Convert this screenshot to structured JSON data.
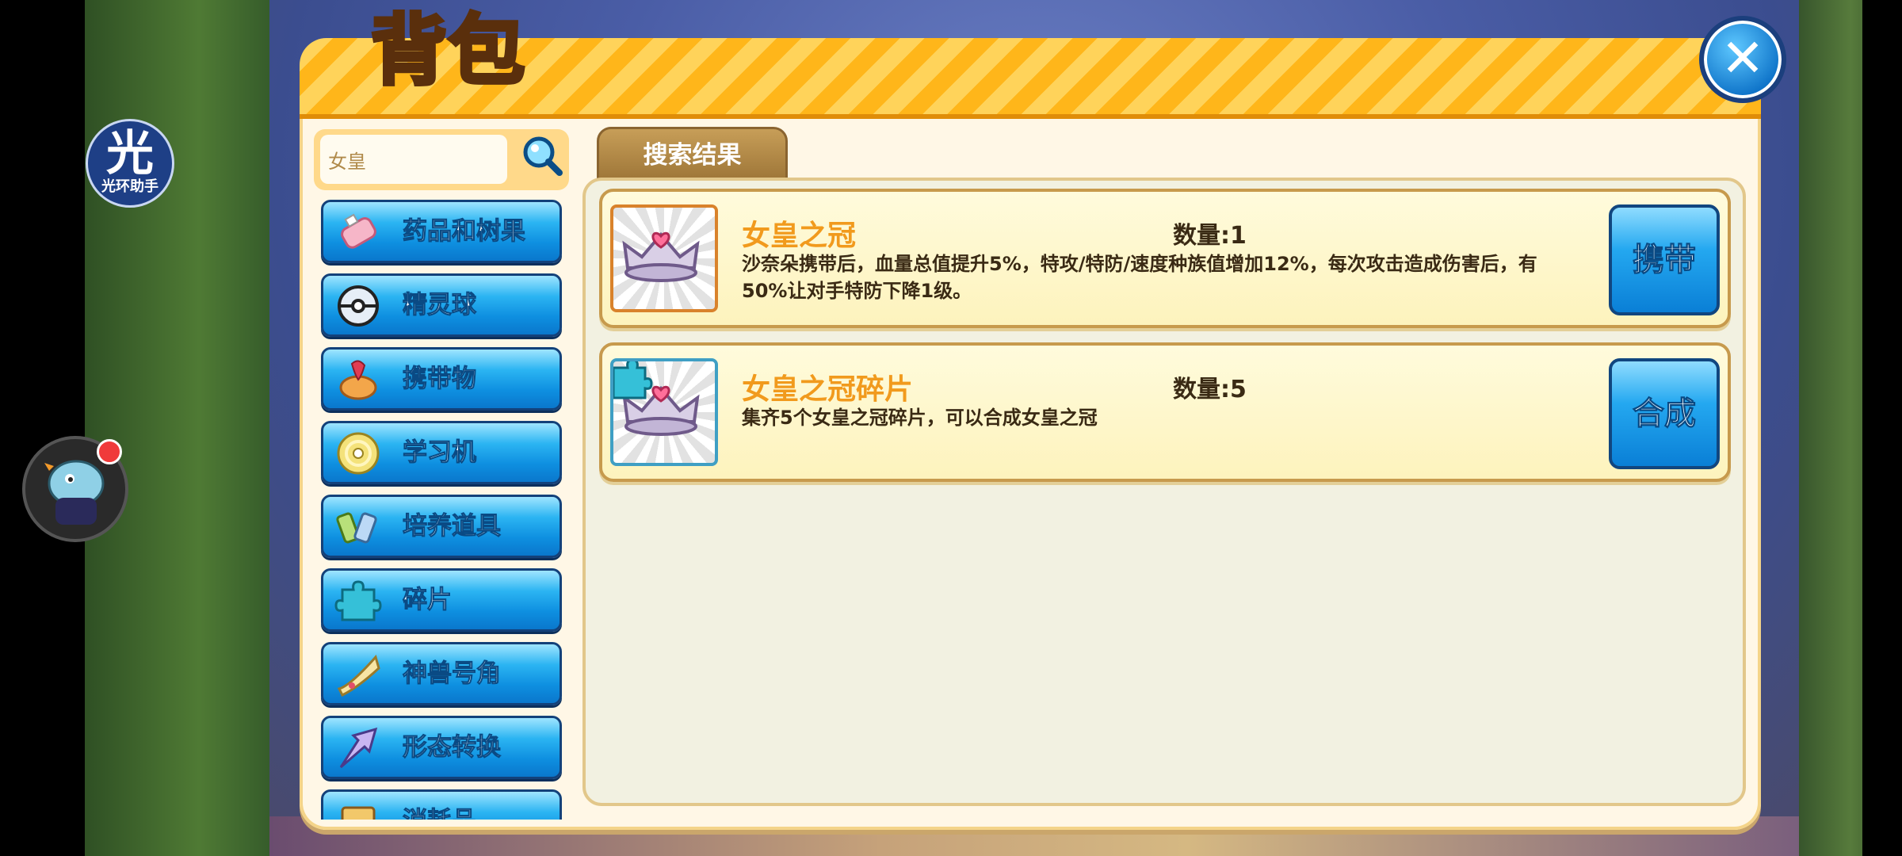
{
  "title": "背包",
  "search": {
    "value": "女皇",
    "placeholder": "女皇"
  },
  "categories": [
    {
      "label": "药品和树果",
      "icon": "potion-icon"
    },
    {
      "label": "精灵球",
      "icon": "pokeball-icon"
    },
    {
      "label": "携带物",
      "icon": "held-item-icon"
    },
    {
      "label": "学习机",
      "icon": "disc-icon"
    },
    {
      "label": "培养道具",
      "icon": "training-item-icon"
    },
    {
      "label": "碎片",
      "icon": "puzzle-piece-icon"
    },
    {
      "label": "神兽号角",
      "icon": "horn-icon"
    },
    {
      "label": "形态转换",
      "icon": "arrow-icon"
    },
    {
      "label": "消耗品",
      "icon": "box-icon"
    }
  ],
  "tab": {
    "label": "搜索结果"
  },
  "results": [
    {
      "name": "女皇之冠",
      "quantity": "数量:1",
      "description": "沙奈朵携带后，血量总值提升5%，特攻/特防/速度种族值增加12%，每次攻击造成伤害后，有50%让对手特防下降1级。",
      "button": "携带",
      "icon": "crown-icon"
    },
    {
      "name": "女皇之冠碎片",
      "quantity": "数量:5",
      "description": "集齐5个女皇之冠碎片，可以合成女皇之冠",
      "button": "合成",
      "icon": "crown-fragment-icon"
    }
  ],
  "overlay": {
    "helper_char": "光",
    "helper_text": "光环助手"
  },
  "colors": {
    "accent_orange": "#ffb61a",
    "button_blue": "#0e8fe0",
    "name_orange": "#f19a1d"
  }
}
